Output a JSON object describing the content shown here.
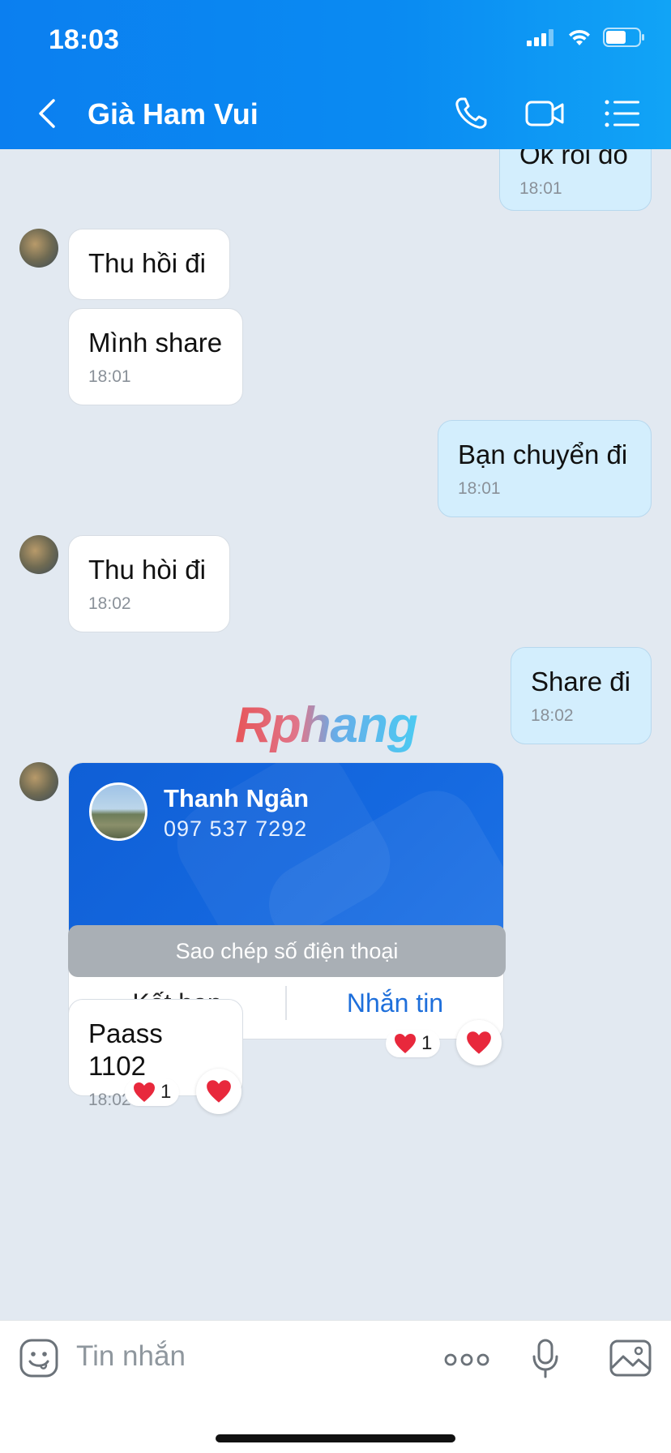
{
  "status_bar": {
    "time": "18:03"
  },
  "header": {
    "title": "Già Ham Vui"
  },
  "messages": [
    {
      "dir": "out",
      "text": "Ok rồi đó",
      "time": "18:01"
    },
    {
      "dir": "in",
      "text": "Thu hồi đi"
    },
    {
      "dir": "in",
      "text": "Mình share",
      "time": "18:01"
    },
    {
      "dir": "out",
      "text": "Bạn chuyển đi",
      "time": "18:01"
    },
    {
      "dir": "in",
      "text": "Thu hòi đi",
      "time": "18:02"
    },
    {
      "dir": "out",
      "text": "Share đi",
      "time": "18:02"
    },
    {
      "dir": "in",
      "text": "Paass 1102",
      "time": "18:02"
    }
  ],
  "contact_card": {
    "name": "Thanh Ngân",
    "phone": "097 537 7292",
    "add_friend_label": "Kết bạn",
    "message_label": "Nhắn tin",
    "reaction_count": "1",
    "copy_label": "Sao chép số điện thoại"
  },
  "paass_reaction_count": "1",
  "watermark": "Rphang",
  "composer": {
    "placeholder": "Tin nhắn"
  },
  "colors": {
    "header": "#0b7ff0",
    "link": "#1e6fdb",
    "out_bubble": "#d3eefd"
  }
}
